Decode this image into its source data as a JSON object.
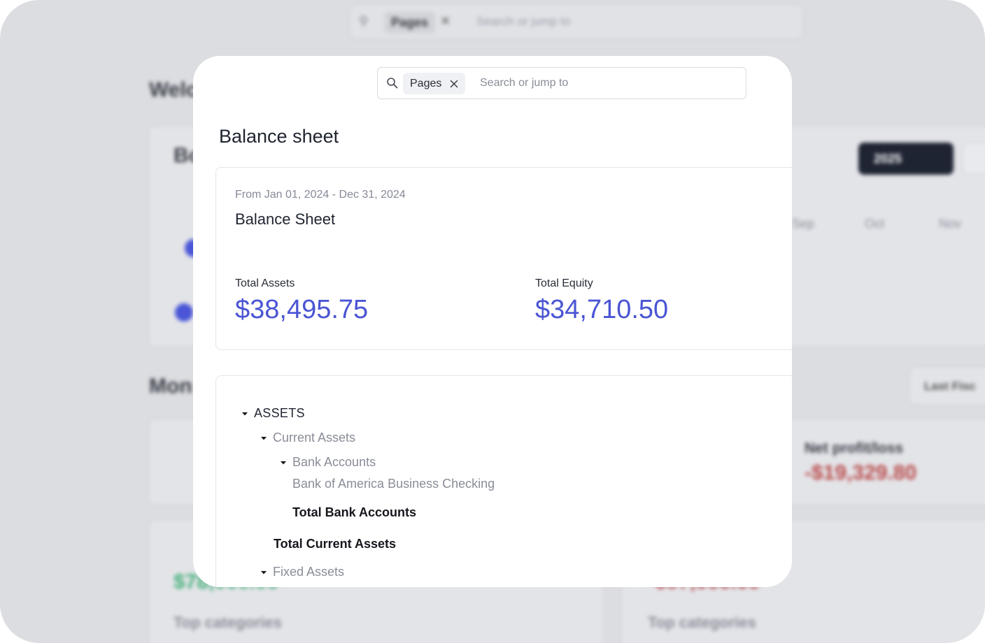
{
  "background": {
    "search": {
      "chip": "Pages",
      "placeholder": "Search or jump to"
    },
    "welcome": "Welc",
    "section_title": "Bo",
    "year_button": "2025",
    "months": [
      "Sep",
      "Oct",
      "Nov"
    ],
    "money_title": "Mon",
    "last_fiscal_button": "Last Fisc",
    "net_profit_label": "Net profit/loss",
    "net_profit_value": "-$19,329.80",
    "green_value": "$78,000.00",
    "red_value": "-$97,000.00",
    "top_categories": "Top categories"
  },
  "search": {
    "chip_label": "Pages",
    "placeholder": "Search or jump to"
  },
  "page": {
    "title": "Balance sheet"
  },
  "summary": {
    "date_range": "From Jan 01, 2024 - Dec 31, 2024",
    "report_title": "Balance Sheet",
    "total_assets_label": "Total Assets",
    "total_assets_value": "$38,495.75",
    "total_equity_label": "Total Equity",
    "total_equity_value": "$34,710.50"
  },
  "tree": {
    "assets": "ASSETS",
    "current_assets": "Current Assets",
    "bank_accounts": "Bank Accounts",
    "bank_account_1": "Bank of America Business Checking",
    "total_bank_accounts": "Total Bank Accounts",
    "total_current_assets": "Total Current Assets",
    "fixed_assets": "Fixed Assets"
  },
  "colors": {
    "accent": "#4a55d4",
    "muted_text": "#8a8d98"
  }
}
